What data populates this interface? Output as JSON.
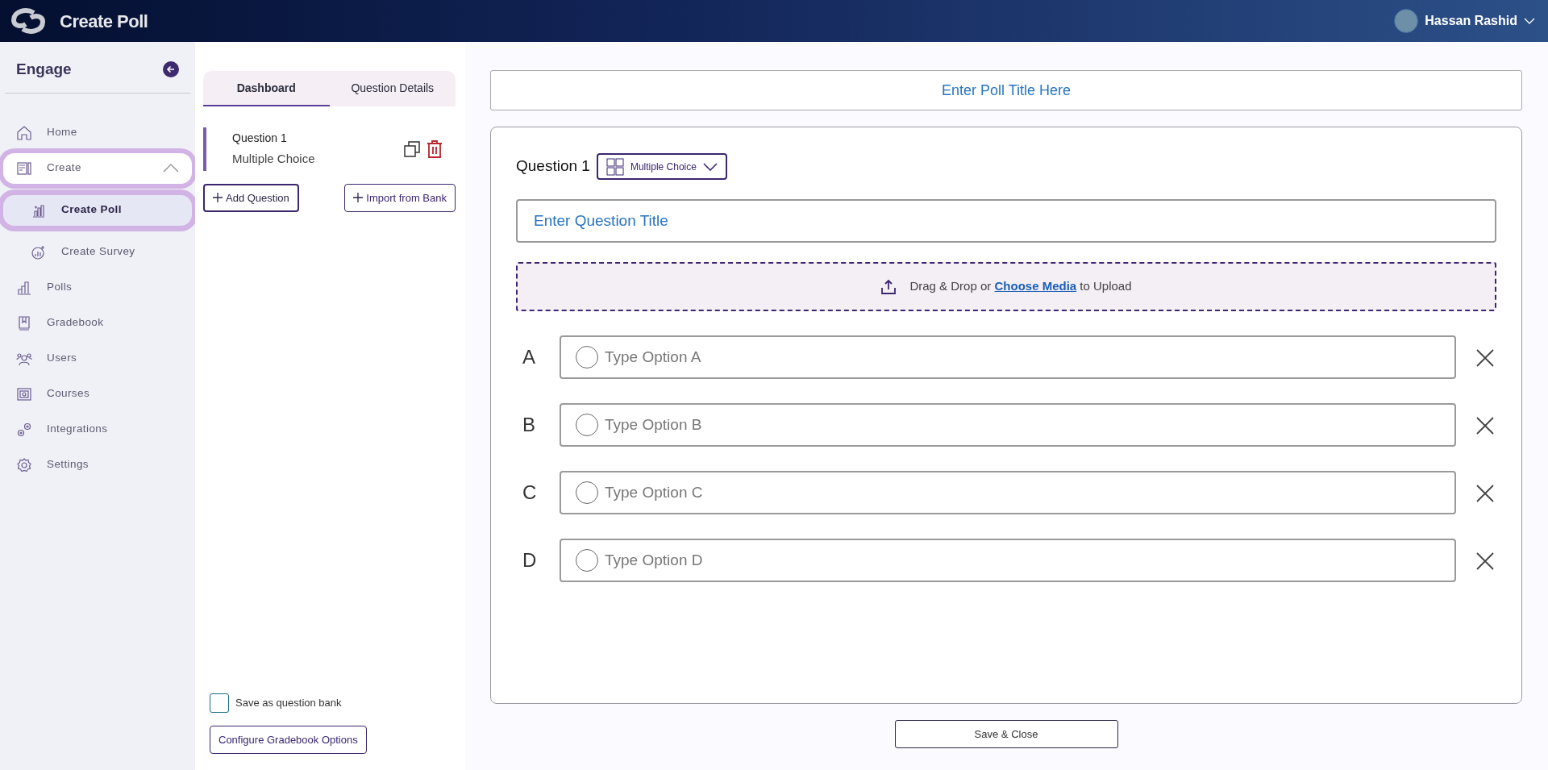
{
  "header": {
    "title": "Create Poll",
    "user": {
      "name": "Hassan Rashid"
    }
  },
  "sidebar": {
    "title": "Engage",
    "items": [
      {
        "label": "Home",
        "selected": false
      },
      {
        "label": "Create",
        "selected": false,
        "expanded": true,
        "children": [
          {
            "label": "Create Poll",
            "selected": true
          },
          {
            "label": "Create Survey",
            "selected": false
          }
        ]
      },
      {
        "label": "Polls",
        "selected": false
      },
      {
        "label": "Gradebook",
        "selected": false
      },
      {
        "label": "Users",
        "selected": false
      },
      {
        "label": "Courses",
        "selected": false
      },
      {
        "label": "Integrations",
        "selected": false
      },
      {
        "label": "Settings",
        "selected": false
      }
    ]
  },
  "panel": {
    "tabs": [
      {
        "label": "Dashboard",
        "selected": true
      },
      {
        "label": "Question Details",
        "selected": false
      }
    ],
    "questions": [
      {
        "title": "Question 1",
        "type": "Multiple Choice",
        "selected": true
      }
    ],
    "buttons": [
      "Add Question",
      "Import from Bank"
    ],
    "save_as_bank": {
      "label": "Save as question bank",
      "checked": false
    },
    "configure_button": "Configure Gradebook Options"
  },
  "editor": {
    "poll_title": {
      "placeholder": "Enter Poll Title Here"
    },
    "question_label": "Question 1",
    "question_type": "Multiple Choice",
    "question_title": {
      "placeholder": "Enter Question Title"
    },
    "upload": {
      "before": "Drag & Drop or",
      "link": "Choose Media",
      "after": "to Upload"
    },
    "options": [
      {
        "letter": "A",
        "placeholder": "Type Option A",
        "selected": false
      },
      {
        "letter": "B",
        "placeholder": "Type Option B",
        "selected": false
      },
      {
        "letter": "C",
        "placeholder": "Type Option C",
        "selected": false
      },
      {
        "letter": "D",
        "placeholder": "Type Option D",
        "selected": false
      }
    ]
  },
  "save_button": "Save & Close"
}
